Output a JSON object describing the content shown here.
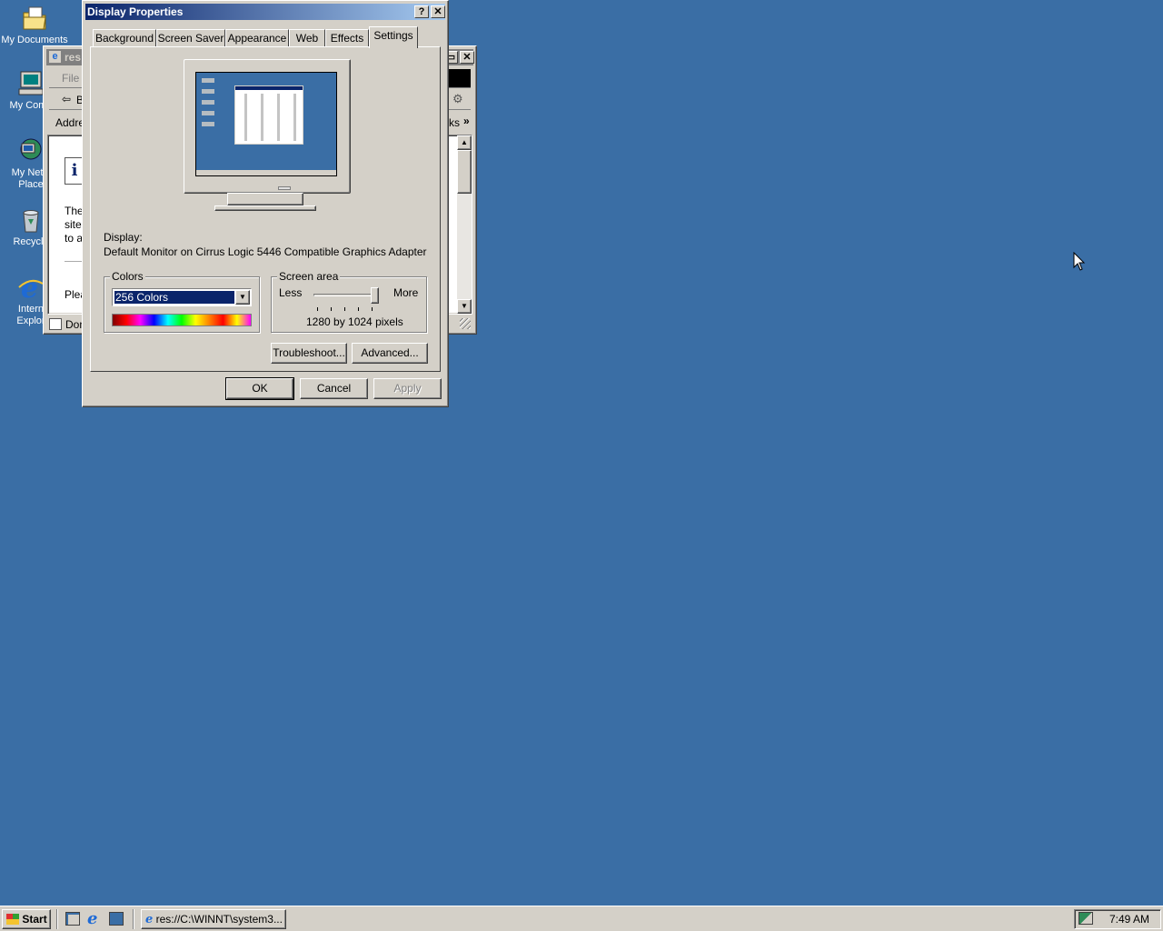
{
  "desktop": {
    "icons": [
      {
        "label": "My Documents",
        "icon": "my-documents-icon"
      },
      {
        "label": "My Comp",
        "icon": "my-computer-icon"
      },
      {
        "label_line1": "My Netw",
        "label_line2": "Place",
        "icon": "network-places-icon"
      },
      {
        "label": "Recycle",
        "icon": "recycle-bin-icon"
      },
      {
        "label_line1": "Intern",
        "label_line2": "Explor",
        "icon": "internet-explorer-icon"
      }
    ]
  },
  "background_window": {
    "title": "res:",
    "menu_file": "File",
    "back_label": "B",
    "address_label": "Addre",
    "links_label": "ks",
    "body_lines": [
      "The",
      "site",
      "to a"
    ],
    "body_please": "Plea",
    "status": "Don"
  },
  "dialog": {
    "title": "Display Properties",
    "help_glyph": "?",
    "close_glyph": "✕",
    "tabs": [
      "Background",
      "Screen Saver",
      "Appearance",
      "Web",
      "Effects",
      "Settings"
    ],
    "active_tab": "Settings",
    "display_label": "Display:",
    "display_value": "Default Monitor on Cirrus Logic 5446 Compatible Graphics Adapter",
    "colors_group": "Colors",
    "colors_selected": "256 Colors",
    "screen_area_group": "Screen area",
    "slider_less": "Less",
    "slider_more": "More",
    "slider_level_fraction": 1.0,
    "resolution_text": "1280 by 1024 pixels",
    "troubleshoot_button": "Troubleshoot...",
    "advanced_button": "Advanced...",
    "ok_button": "OK",
    "cancel_button": "Cancel",
    "apply_button": "Apply"
  },
  "taskbar": {
    "start_label": "Start",
    "quicklaunch": [
      "show-desktop-icon",
      "ie-quicklaunch-icon",
      "outlook-quicklaunch-icon"
    ],
    "task_label": "res://C:\\WINNT\\system3...",
    "clock": "7:49 AM"
  },
  "colors": {
    "desktop": "#3a6ea5",
    "titlebar_active": "#0a246a",
    "face": "#d4d0c8",
    "selection": "#0a246a"
  }
}
